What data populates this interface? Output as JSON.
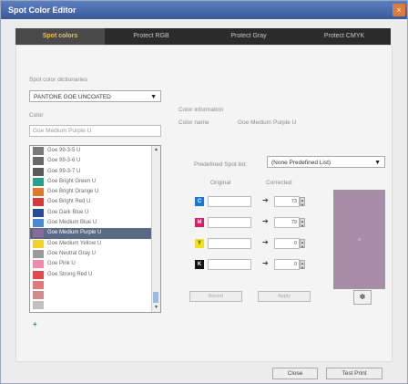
{
  "window": {
    "title": "Spot Color Editor",
    "close_glyph": "×",
    "accent": "#3a5a9a"
  },
  "tabs": [
    {
      "label": "Spot colors",
      "active": true
    },
    {
      "label": "Protect RGB",
      "active": false
    },
    {
      "label": "Protect Gray",
      "active": false
    },
    {
      "label": "Protect CMYK",
      "active": false
    }
  ],
  "left": {
    "dictionaries_label": "Spot color dictionaries",
    "dictionary_value": "PANTONE GOE UNCOATED",
    "color_label": "Color",
    "search_value": "Goe Medium Purple U",
    "add_glyph": "+"
  },
  "colors": [
    {
      "name": "Goe 99-3-5 U",
      "color": "#7a7a7a",
      "selected": false
    },
    {
      "name": "Goe 99-3-6 U",
      "color": "#6a6a6a",
      "selected": false
    },
    {
      "name": "Goe 99-3-7 U",
      "color": "#5a5a5a",
      "selected": false
    },
    {
      "name": "Goe Bright Green U",
      "color": "#2aa08a",
      "selected": false
    },
    {
      "name": "Goe Bright Orange U",
      "color": "#e07a2a",
      "selected": false
    },
    {
      "name": "Goe Bright Red U",
      "color": "#d83a3a",
      "selected": false
    },
    {
      "name": "Goe Dark Blue U",
      "color": "#2a4a9a",
      "selected": false
    },
    {
      "name": "Goe Medium Blue U",
      "color": "#4a8ad0",
      "selected": false
    },
    {
      "name": "Goe Medium Purple U",
      "color": "#8a6a9a",
      "selected": true
    },
    {
      "name": "Goe Medium Yellow U",
      "color": "#f0d02a",
      "selected": false
    },
    {
      "name": "Goe Neutral Gray U",
      "color": "#9a9a9a",
      "selected": false
    },
    {
      "name": "Goe Pink U",
      "color": "#f08aaa",
      "selected": false
    },
    {
      "name": "Goe Strong Red U",
      "color": "#e04a4a",
      "selected": false
    },
    {
      "name": "",
      "color": "#e07a7a",
      "selected": false
    },
    {
      "name": "",
      "color": "#d08a8a",
      "selected": false
    },
    {
      "name": "",
      "color": "#c0c0c0",
      "selected": false
    }
  ],
  "info": {
    "heading": "Color information",
    "name_label": "Color name",
    "name_value": "Goe Medium Purple U",
    "predefined_label": "Predefined Spot list:",
    "predefined_value": "(None Predefined List)",
    "original_label": "Original",
    "corrected_label": "Corrected"
  },
  "channels": [
    {
      "letter": "C",
      "color": "#1a78d0",
      "letter_color": "#ffffff",
      "original": "",
      "corrected": "73"
    },
    {
      "letter": "M",
      "color": "#d8206a",
      "letter_color": "#ffffff",
      "original": "",
      "corrected": "79"
    },
    {
      "letter": "Y",
      "color": "#f0e020",
      "letter_color": "#333333",
      "original": "",
      "corrected": "0"
    },
    {
      "letter": "K",
      "color": "#111111",
      "letter_color": "#ffffff",
      "original": "",
      "corrected": "0"
    }
  ],
  "preview": {
    "color": "#a88ca8"
  },
  "actions": {
    "left_label": "Revert",
    "right_label": "Apply",
    "mix_icon": "color-mix-icon"
  },
  "footer": {
    "close_label": "Close",
    "test_print_label": "Test Print"
  }
}
